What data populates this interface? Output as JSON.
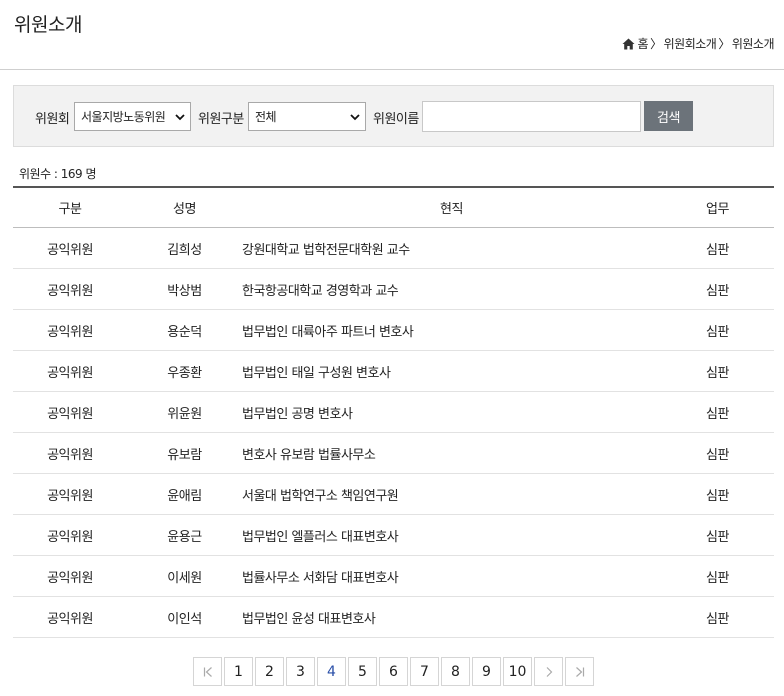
{
  "page": {
    "title": "위원소개"
  },
  "breadcrumb": {
    "home": "홈",
    "level1": "위원회소개",
    "level2": "위원소개",
    "separator": "〉"
  },
  "search": {
    "committee_label": "위원회",
    "committee_value": "서울지방노동위원",
    "type_label": "위원구분",
    "type_value": "전체",
    "name_label": "위원이름",
    "name_value": "",
    "button_label": "검색"
  },
  "count": {
    "text": "위원수 : 169 명"
  },
  "table": {
    "headers": [
      "구분",
      "성명",
      "현직",
      "업무"
    ],
    "rows": [
      [
        "공익위원",
        "김희성",
        "강원대학교 법학전문대학원 교수",
        "심판"
      ],
      [
        "공익위원",
        "박상범",
        "한국항공대학교 경영학과 교수",
        "심판"
      ],
      [
        "공익위원",
        "용순덕",
        "법무법인 대륙아주 파트너 변호사",
        "심판"
      ],
      [
        "공익위원",
        "우종환",
        "법무법인 태일 구성원 변호사",
        "심판"
      ],
      [
        "공익위원",
        "위윤원",
        "법무법인 공명 변호사",
        "심판"
      ],
      [
        "공익위원",
        "유보람",
        "변호사 유보람 법률사무소",
        "심판"
      ],
      [
        "공익위원",
        "윤애림",
        "서울대 법학연구소 책임연구원",
        "심판"
      ],
      [
        "공익위원",
        "윤용근",
        "법무법인 엘플러스 대표변호사",
        "심판"
      ],
      [
        "공익위원",
        "이세원",
        "법률사무소 서화담 대표변호사",
        "심판"
      ],
      [
        "공익위원",
        "이인석",
        "법무법인 윤성 대표변호사",
        "심판"
      ]
    ]
  },
  "pagination": {
    "pages": [
      "1",
      "2",
      "3",
      "4",
      "5",
      "6",
      "7",
      "8",
      "9",
      "10"
    ],
    "current": "4",
    "first_icon": "first-page-icon",
    "next_icon": "next-page-icon",
    "last_icon": "last-page-icon"
  },
  "colors": {
    "search_button": "#6c737a",
    "current_page": "#2a4fa8"
  }
}
